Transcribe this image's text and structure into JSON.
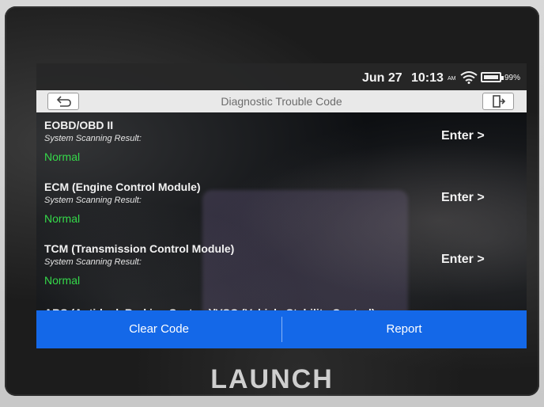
{
  "status_bar": {
    "date": "Jun 27",
    "time": "10:13",
    "ampm": "AM",
    "battery": "99%",
    "battery_level": 0.99,
    "icons": [
      "wifi-icon",
      "battery-icon"
    ]
  },
  "titlebar": {
    "title": "Diagnostic Trouble Code",
    "back_icon": "back-arrow-icon",
    "exit_icon": "exit-icon"
  },
  "results": [
    {
      "title": "EOBD/OBD II",
      "subtitle": "System Scanning Result:",
      "status": "Normal",
      "action": "Enter >"
    },
    {
      "title": "ECM (Engine Control Module)",
      "subtitle": "System Scanning Result:",
      "status": "Normal",
      "action": "Enter >"
    },
    {
      "title": "TCM (Transmission Control Module)",
      "subtitle": "System Scanning Result:",
      "status": "Normal",
      "action": "Enter >"
    }
  ],
  "partial_item": "ABS (Anti-lock Braking System)/VSC (Vehicle Stability Control)",
  "actions": {
    "clear_code": "Clear Code",
    "report": "Report"
  },
  "colors": {
    "accent": "#1468e8",
    "status_normal": "#35d94a",
    "titlebar_bg": "#e9e9e9"
  },
  "device": {
    "brand": "LAUNCH"
  }
}
